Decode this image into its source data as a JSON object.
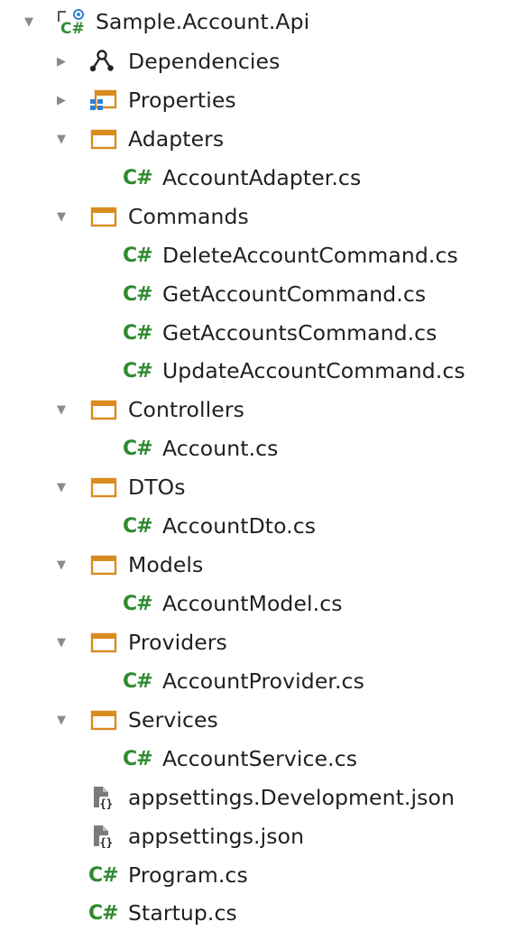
{
  "tree": {
    "root": {
      "label": "Sample.Account.Api",
      "expanded": true,
      "icon": "csharp-project-icon"
    },
    "dependencies": {
      "label": "Dependencies",
      "expanded": false,
      "icon": "dependencies-icon"
    },
    "properties": {
      "label": "Properties",
      "expanded": false,
      "icon": "properties-icon"
    },
    "adapters": {
      "label": "Adapters",
      "expanded": true,
      "icon": "folder-icon",
      "files": [
        {
          "label": "AccountAdapter.cs",
          "icon": "csharp-file-icon"
        }
      ]
    },
    "commands": {
      "label": "Commands",
      "expanded": true,
      "icon": "folder-icon",
      "files": [
        {
          "label": "DeleteAccountCommand.cs",
          "icon": "csharp-file-icon"
        },
        {
          "label": "GetAccountCommand.cs",
          "icon": "csharp-file-icon"
        },
        {
          "label": "GetAccountsCommand.cs",
          "icon": "csharp-file-icon"
        },
        {
          "label": "UpdateAccountCommand.cs",
          "icon": "csharp-file-icon"
        }
      ]
    },
    "controllers": {
      "label": "Controllers",
      "expanded": true,
      "icon": "folder-icon",
      "files": [
        {
          "label": "Account.cs",
          "icon": "csharp-file-icon"
        }
      ]
    },
    "dtos": {
      "label": "DTOs",
      "expanded": true,
      "icon": "folder-icon",
      "files": [
        {
          "label": "AccountDto.cs",
          "icon": "csharp-file-icon"
        }
      ]
    },
    "models": {
      "label": "Models",
      "expanded": true,
      "icon": "folder-icon",
      "files": [
        {
          "label": "AccountModel.cs",
          "icon": "csharp-file-icon"
        }
      ]
    },
    "providers": {
      "label": "Providers",
      "expanded": true,
      "icon": "folder-icon",
      "files": [
        {
          "label": "AccountProvider.cs",
          "icon": "csharp-file-icon"
        }
      ]
    },
    "services": {
      "label": "Services",
      "expanded": true,
      "icon": "folder-icon",
      "files": [
        {
          "label": "AccountService.cs",
          "icon": "csharp-file-icon"
        }
      ]
    },
    "root_files": [
      {
        "label": "appsettings.Development.json",
        "icon": "json-settings-icon"
      },
      {
        "label": "appsettings.json",
        "icon": "json-settings-icon"
      },
      {
        "label": "Program.cs",
        "icon": "csharp-file-icon"
      },
      {
        "label": "Startup.cs",
        "icon": "csharp-file-icon"
      }
    ]
  },
  "glyphs": {
    "expanded_arrow": "▼",
    "collapsed_arrow": "▶",
    "csharp": "C#"
  },
  "colors": {
    "folder": "#d98c1e",
    "csharp": "#2f8a2f",
    "arrow": "#8a8a8a",
    "properties_blue": "#2f7fd6",
    "text": "#1f1f1f"
  }
}
